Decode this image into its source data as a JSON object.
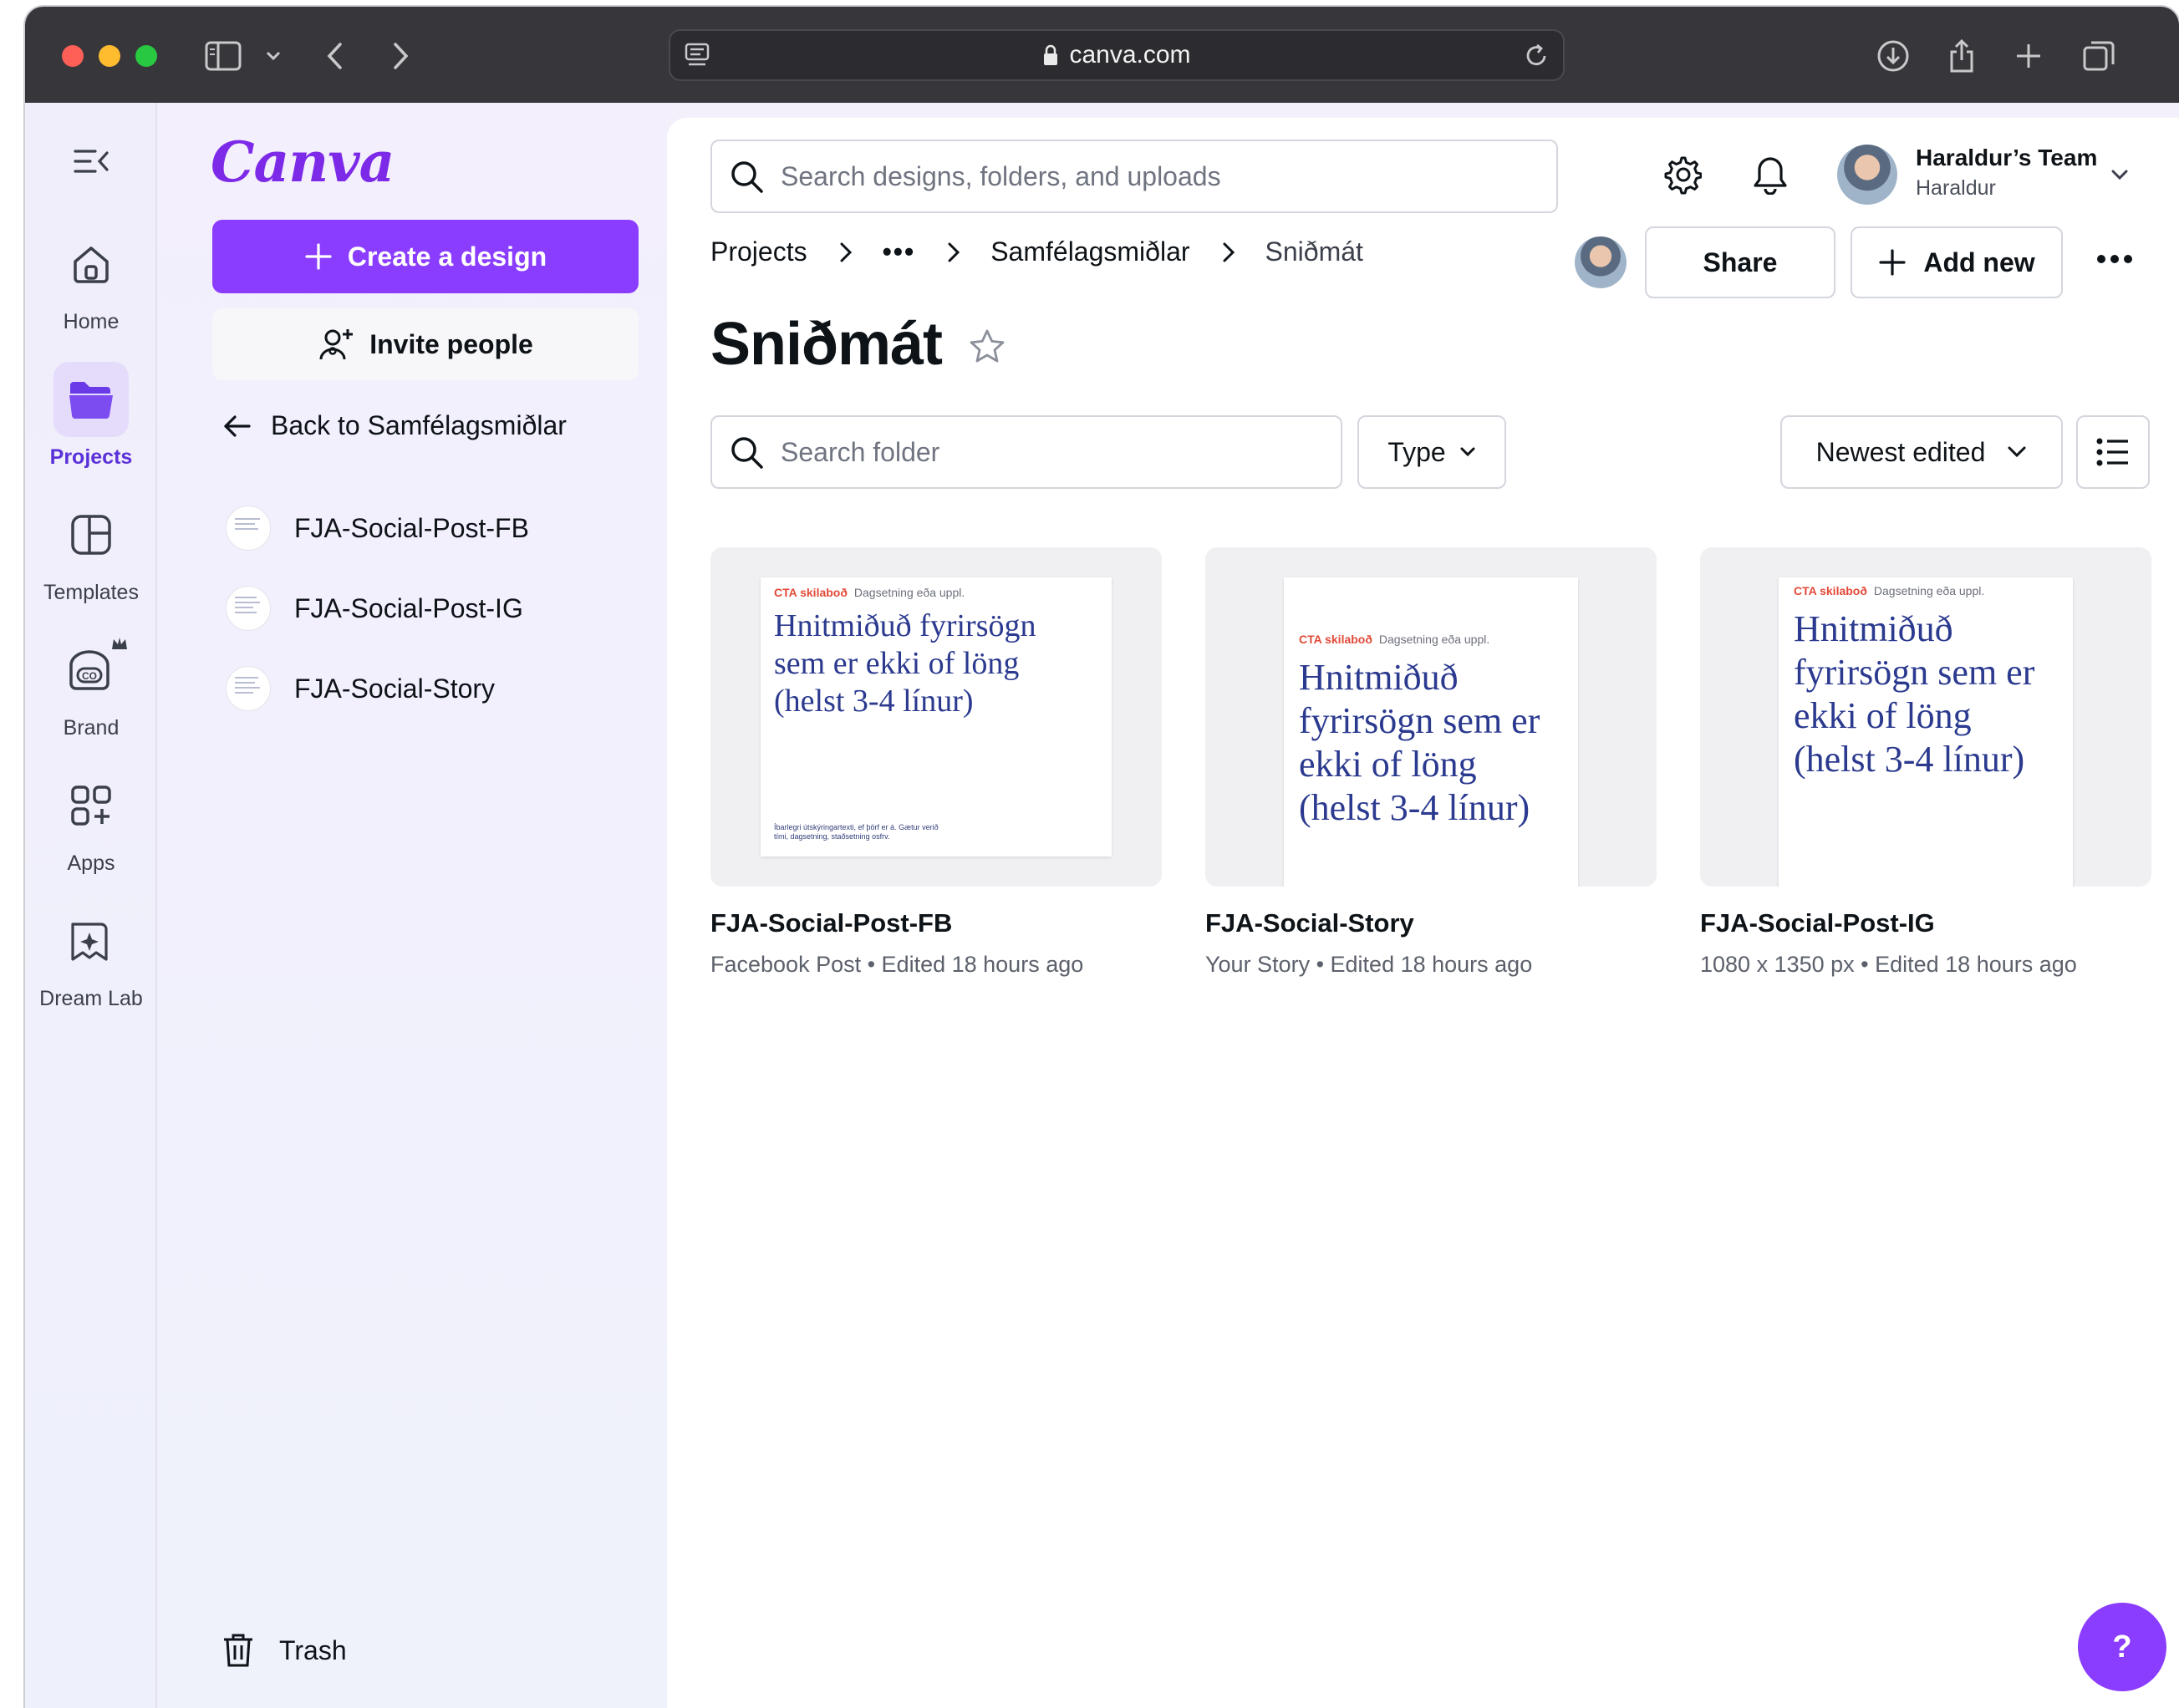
{
  "browser": {
    "url": "canva.com"
  },
  "brand": {
    "logo_text": "Canva",
    "accent": "#8b3dff"
  },
  "rail": {
    "items": [
      {
        "label": "Home",
        "icon": "home-icon"
      },
      {
        "label": "Projects",
        "icon": "folder-icon"
      },
      {
        "label": "Templates",
        "icon": "templates-icon"
      },
      {
        "label": "Brand",
        "icon": "brand-icon"
      },
      {
        "label": "Apps",
        "icon": "apps-icon"
      },
      {
        "label": "Dream Lab",
        "icon": "dream-lab-icon"
      }
    ]
  },
  "panel": {
    "create_label": "Create a design",
    "invite_label": "Invite people",
    "back_label": "Back to Samfélagsmiðlar",
    "folder_items": [
      "FJA-Social-Post-FB",
      "FJA-Social-Post-IG",
      "FJA-Social-Story"
    ],
    "trash_label": "Trash"
  },
  "header": {
    "search_placeholder": "Search designs, folders, and uploads",
    "team_name": "Haraldur’s Team",
    "user_name": "Haraldur"
  },
  "breadcrumb": {
    "items": [
      "Projects",
      "•••",
      "Samfélagsmiðlar",
      "Sniðmát"
    ]
  },
  "actions": {
    "share_label": "Share",
    "add_new_label": "Add new"
  },
  "page": {
    "title": "Sniðmát"
  },
  "toolbar": {
    "folder_search_placeholder": "Search folder",
    "type_label": "Type",
    "sort_label": "Newest edited"
  },
  "designs": [
    {
      "title": "FJA-Social-Post-FB",
      "meta": "Facebook Post • Edited 18 hours ago",
      "preview": {
        "cta": "CTA skilaboð",
        "date": "Dagsetning eða uppl.",
        "headline": "Hnitmiðuð fyrirsögn sem er ekki of löng (helst 3-4 línur)",
        "fine_print": "Íbarlegri útskýringartexti, ef þörf er á. Gætur verið tími, dagsetning, staðsetning osfrv."
      }
    },
    {
      "title": "FJA-Social-Story",
      "meta": "Your Story • Edited 18 hours ago",
      "preview": {
        "cta": "CTA skilaboð",
        "date": "Dagsetning eða uppl.",
        "headline": "Hnitmiðuð fyrirsögn sem er ekki of löng (helst 3-4 línur)"
      }
    },
    {
      "title": "FJA-Social-Post-IG",
      "meta": "1080 x 1350 px • Edited 18 hours ago",
      "preview": {
        "cta": "CTA skilaboð",
        "date": "Dagsetning eða uppl.",
        "headline": "Hnitmiðuð fyrirsögn sem er ekki of löng (helst 3-4 línur)"
      }
    }
  ],
  "help": {
    "label": "?"
  }
}
